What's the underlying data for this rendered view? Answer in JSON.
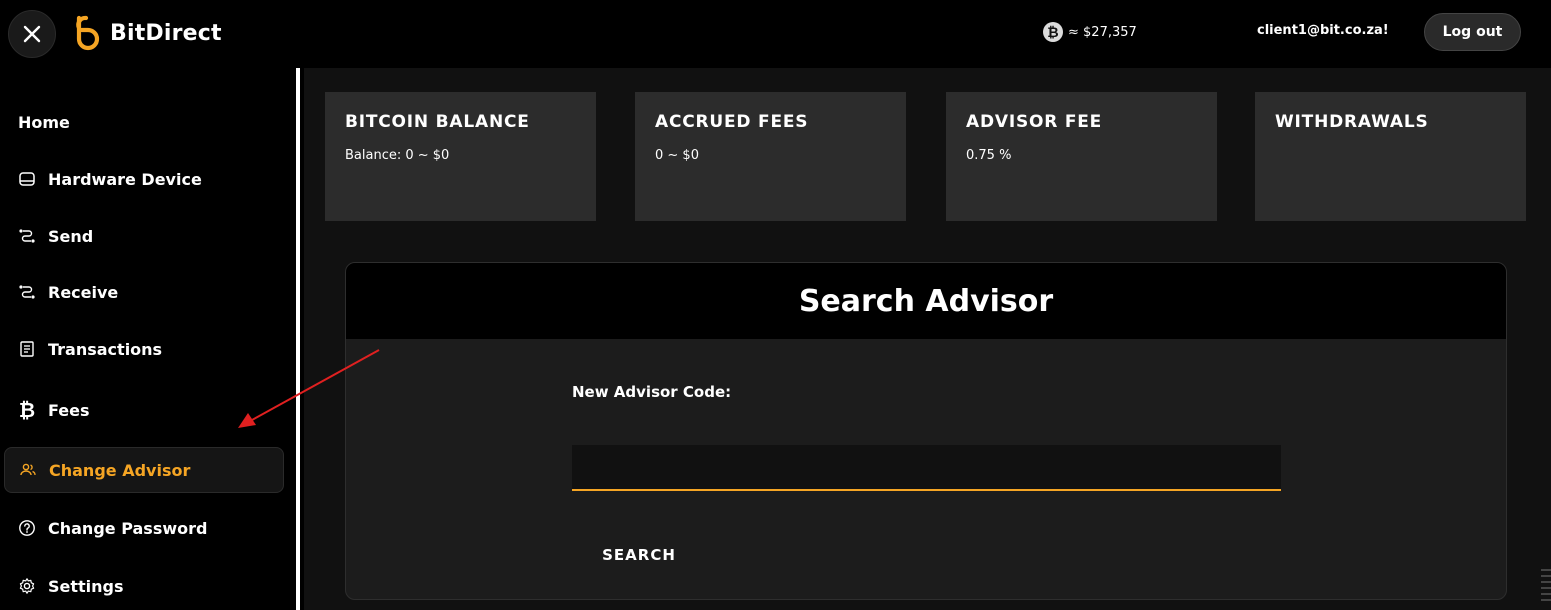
{
  "header": {
    "brand": "BitDirect",
    "btc_price": "≈ $27,357",
    "user_email": "client1@bit.co.za!",
    "logout_label": "Log out"
  },
  "sidebar": {
    "items": [
      {
        "label": "Home",
        "icon": "none"
      },
      {
        "label": "Hardware Device",
        "icon": "device-icon"
      },
      {
        "label": "Send",
        "icon": "route-icon"
      },
      {
        "label": "Receive",
        "icon": "route-icon"
      },
      {
        "label": "Transactions",
        "icon": "receipt-icon"
      },
      {
        "label": "Fees",
        "icon": "bitcoin-icon"
      },
      {
        "label": "Change Advisor",
        "icon": "users-icon",
        "active": true
      },
      {
        "label": "Change Password",
        "icon": "question-icon"
      },
      {
        "label": "Settings",
        "icon": "gear-icon"
      }
    ]
  },
  "cards": [
    {
      "title": "BITCOIN BALANCE",
      "value": "Balance: 0 ~ $0"
    },
    {
      "title": "ACCRUED FEES",
      "value": "0 ~ $0"
    },
    {
      "title": "ADVISOR FEE",
      "value": "0.75 %"
    },
    {
      "title": "WITHDRAWALS",
      "value": ""
    }
  ],
  "search_advisor": {
    "title": "Search Advisor",
    "field_label": "New Advisor Code:",
    "input_value": "",
    "button_label": "SEARCH"
  },
  "colors": {
    "accent": "#f5a524",
    "background": "#000000",
    "card": "#2c2c2c",
    "annotation_arrow": "#e02020"
  }
}
